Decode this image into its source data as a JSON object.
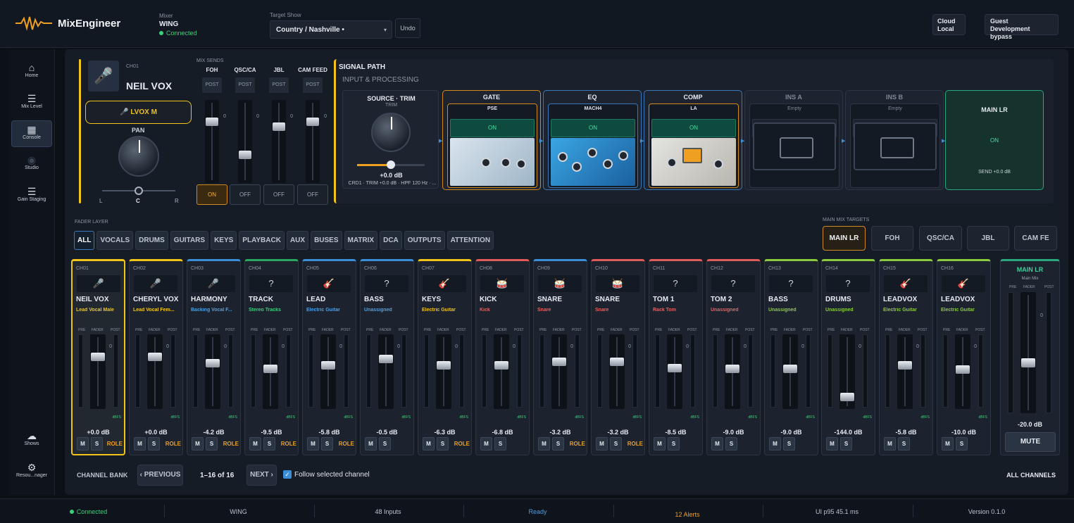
{
  "header": {
    "app_name": "MixEngineer",
    "mixer_label": "Mixer",
    "mixer_name": "WING",
    "mixer_status": "Connected",
    "target_show_label": "Target Show",
    "target_show_value": "Country / Nashville •",
    "undo_label": "Undo",
    "cloud_line1": "Cloud",
    "cloud_line2": "Local",
    "guest_line1": "Guest",
    "guest_line2": "Development bypass"
  },
  "sidebar": {
    "items": [
      {
        "label": "Home",
        "icon": "home-icon"
      },
      {
        "label": "Mix Level",
        "icon": "mix-level-icon"
      },
      {
        "label": "Console",
        "icon": "console-icon"
      },
      {
        "label": "Studio",
        "icon": "studio-icon"
      },
      {
        "label": "Gain Staging",
        "icon": "gain-staging-icon"
      },
      {
        "label": "Shows",
        "icon": "shows-icon"
      },
      {
        "label": "Resou...nager",
        "icon": "gear-icon"
      }
    ],
    "active": "Console"
  },
  "detail": {
    "channel_id": "CH01",
    "channel_name": "NEIL VOX",
    "role_button": "LVOX M",
    "pan_label": "PAN",
    "pan_left": "L",
    "pan_center": "C",
    "pan_right": "R",
    "pan_value": 0.5,
    "sends_label": "MIX SENDS",
    "sends": [
      {
        "name": "FOH",
        "post": "POST",
        "zero": "0",
        "state": "ON",
        "level": 0.22
      },
      {
        "name": "QSC/CA",
        "post": "POST",
        "zero": "0",
        "state": "OFF",
        "level": 0.72
      },
      {
        "name": "JBL",
        "post": "POST",
        "zero": "0",
        "state": "OFF",
        "level": 0.3
      },
      {
        "name": "CAM FEED",
        "post": "POST",
        "zero": "0",
        "state": "OFF",
        "level": 0.22
      }
    ]
  },
  "signal_path": {
    "title": "SIGNAL PATH",
    "subtitle": "INPUT & PROCESSING",
    "source": {
      "title": "SOURCE · TRIM",
      "trim_label": "TRIM",
      "db": "+0.0 dB",
      "info": "CRD1 · TRIM +0.0 dB · HPF 120 Hz · ...",
      "trim_level": 0.5
    },
    "slots": [
      {
        "title": "GATE",
        "plugin": "PSE",
        "state": "ON",
        "kind": "gate"
      },
      {
        "title": "EQ",
        "plugin": "MACH4",
        "state": "ON",
        "kind": "eq"
      },
      {
        "title": "COMP",
        "plugin": "LA",
        "state": "ON",
        "kind": "comp"
      },
      {
        "title": "INS A",
        "plugin": "Empty",
        "state": "EMPTY",
        "kind": "empty"
      },
      {
        "title": "INS B",
        "plugin": "Empty",
        "state": "EMPTY",
        "kind": "empty"
      }
    ],
    "main": {
      "title": "MAIN LR",
      "state": "ON",
      "send": "SEND +0.0 dB"
    }
  },
  "fader_layer": {
    "label": "FADER LAYER",
    "tabs": [
      "ALL",
      "VOCALS",
      "DRUMS",
      "GUITARS",
      "KEYS",
      "PLAYBACK",
      "AUX",
      "BUSES",
      "MATRIX",
      "DCA",
      "OUTPUTS",
      "ATTENTION"
    ],
    "active": "ALL"
  },
  "main_mix_targets": {
    "label": "MAIN MIX TARGETS",
    "items": [
      "MAIN LR",
      "FOH",
      "QSC/CA",
      "JBL",
      "CAM FE"
    ],
    "active": "MAIN LR"
  },
  "strip_labels": {
    "pre": "PRE",
    "fader": "FADER",
    "post": "POST",
    "dbfs": "dBFS",
    "zero": "0",
    "mute": "M",
    "solo": "S",
    "role": "ROLE"
  },
  "channels": [
    {
      "id": "CH01",
      "name": "NEIL VOX",
      "role": "Lead Vocal Male",
      "db": "+0.0 dB",
      "color": "#f0c419",
      "role_color": "#f0c419",
      "icon": "microphone-icon",
      "glyph": "🎤",
      "level": 0.26,
      "role_btn": true,
      "selected": true
    },
    {
      "id": "CH02",
      "name": "CHERYL VOX",
      "role": "Lead Vocal Fem...",
      "db": "+0.0 dB",
      "color": "#f0c419",
      "role_color": "#f0c419",
      "icon": "microphone-icon",
      "glyph": "🎤",
      "level": 0.26,
      "role_btn": true
    },
    {
      "id": "CH03",
      "name": "HARMONY",
      "role": "Backing Vocal F...",
      "db": "-4.2 dB",
      "color": "#3a8fd8",
      "role_color": "#4aa0e8",
      "icon": "microphone-icon",
      "glyph": "🎤",
      "level": 0.36,
      "role_btn": true
    },
    {
      "id": "CH04",
      "name": "TRACK",
      "role": "Stereo Tracks",
      "db": "-9.5 dB",
      "color": "#2aa860",
      "role_color": "#3ccf7a",
      "icon": "question-icon",
      "glyph": "?",
      "level": 0.45,
      "role_btn": true
    },
    {
      "id": "CH05",
      "name": "LEAD",
      "role": "Electric Guitar",
      "db": "-5.8 dB",
      "color": "#3a8fd8",
      "role_color": "#4aa0e8",
      "icon": "guitar-icon",
      "glyph": "🎸",
      "level": 0.39,
      "role_btn": true
    },
    {
      "id": "CH06",
      "name": "BASS",
      "role": "Unassigned",
      "db": "-0.5 dB",
      "color": "#3a8fd8",
      "role_color": "#4aa0e8",
      "icon": "question-icon",
      "glyph": "?",
      "level": 0.29,
      "role_btn": false
    },
    {
      "id": "CH07",
      "name": "KEYS",
      "role": "Electric Guitar",
      "db": "-6.3 dB",
      "color": "#f0c419",
      "role_color": "#f0c419",
      "icon": "guitar-icon",
      "glyph": "🎸",
      "level": 0.4,
      "role_btn": true
    },
    {
      "id": "CH08",
      "name": "KICK",
      "role": "Kick",
      "db": "-6.8 dB",
      "color": "#e05a5a",
      "role_color": "#e86060",
      "icon": "drum-icon",
      "glyph": "🥁",
      "level": 0.4,
      "role_btn": false
    },
    {
      "id": "CH09",
      "name": "SNARE",
      "role": "Snare",
      "db": "-3.2 dB",
      "color": "#3a8fd8",
      "role_color": "#e86060",
      "icon": "drum-icon",
      "glyph": "🥁",
      "level": 0.34,
      "role_btn": true
    },
    {
      "id": "CH10",
      "name": "SNARE",
      "role": "Snare",
      "db": "-3.2 dB",
      "color": "#e05a5a",
      "role_color": "#e86060",
      "icon": "drum-icon",
      "glyph": "🥁",
      "level": 0.34,
      "role_btn": true
    },
    {
      "id": "CH11",
      "name": "TOM 1",
      "role": "Rack Tom",
      "db": "-8.5 dB",
      "color": "#e05a5a",
      "role_color": "#e86060",
      "icon": "question-icon",
      "glyph": "?",
      "level": 0.44,
      "role_btn": false
    },
    {
      "id": "CH12",
      "name": "TOM 2",
      "role": "Unassigned",
      "db": "-9.0 dB",
      "color": "#e05a5a",
      "role_color": "#e86060",
      "icon": "question-icon",
      "glyph": "?",
      "level": 0.45,
      "role_btn": false
    },
    {
      "id": "CH13",
      "name": "BASS",
      "role": "Unassigned",
      "db": "-9.0 dB",
      "color": "#8acb3c",
      "role_color": "#8acb3c",
      "icon": "question-icon",
      "glyph": "?",
      "level": 0.45,
      "role_btn": false
    },
    {
      "id": "CH14",
      "name": "DRUMS",
      "role": "Unassigned",
      "db": "-144.0 dB",
      "color": "#8acb3c",
      "role_color": "#8acb3c",
      "icon": "question-icon",
      "glyph": "?",
      "level": 0.92,
      "role_btn": false
    },
    {
      "id": "CH15",
      "name": "LEADVOX",
      "role": "Electric Guitar",
      "db": "-5.8 dB",
      "color": "#8acb3c",
      "role_color": "#8acb3c",
      "icon": "guitar-icon",
      "glyph": "🎸",
      "level": 0.39,
      "role_btn": false
    },
    {
      "id": "CH16",
      "name": "LEADVOX",
      "role": "Electric Guitar",
      "db": "-10.0 dB",
      "color": "#8acb3c",
      "role_color": "#8acb3c",
      "icon": "guitar-icon",
      "glyph": "🎸",
      "level": 0.46,
      "role_btn": false
    }
  ],
  "master": {
    "title": "MAIN LR",
    "subtitle": "Main Mix",
    "db": "-20.0 dB",
    "mute_label": "MUTE",
    "level": 0.6
  },
  "channel_bank": {
    "label": "CHANNEL BANK",
    "previous": "‹ PREVIOUS",
    "range": "1–16 of 16",
    "next": "NEXT ›",
    "follow_label": "Follow selected channel",
    "follow_checked": true,
    "all_channels": "ALL CHANNELS"
  },
  "statusbar": [
    {
      "text": "Connected",
      "color": "#3ccf7a"
    },
    {
      "text": "WING",
      "color": "#bcc4cf"
    },
    {
      "text": "48 Inputs",
      "color": "#bcc4cf"
    },
    {
      "text": "Ready",
      "color": "#4aa0e8"
    },
    {
      "text": "12 Alerts",
      "color": "#f0a020"
    },
    {
      "text": "UI p95 45.1 ms",
      "color": "#bcc4cf"
    },
    {
      "text": "Version 0.1.0",
      "color": "#bcc4cf"
    }
  ],
  "colors": {
    "accent": "#f0c419",
    "active_blue": "#3a78b8",
    "on_green": "#45e0a4"
  }
}
